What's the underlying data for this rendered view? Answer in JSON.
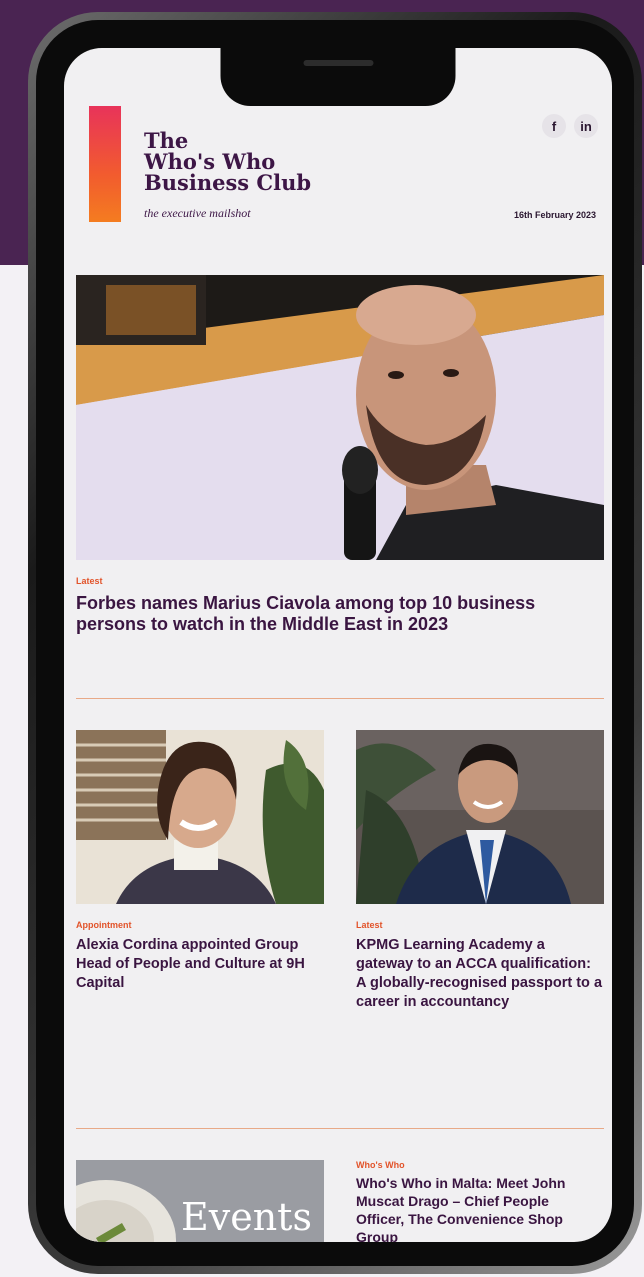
{
  "header": {
    "logo_line1": "The",
    "logo_line2": "Who's Who",
    "logo_line3": "Business Club",
    "tagline": "the executive mailshot",
    "social": [
      {
        "label": "f",
        "icon": "facebook-icon"
      },
      {
        "label": "in",
        "icon": "linkedin-icon"
      }
    ],
    "date": "16th February 2023"
  },
  "hero": {
    "category": "Latest",
    "title": "Forbes names Marius Ciavola among top 10 business persons to watch in the Middle East in 2023"
  },
  "cards": [
    {
      "category": "Appointment",
      "title": "Alexia Cordina appointed Group Head of People and Culture at 9H Capital"
    },
    {
      "category": "Latest",
      "title": "KPMG Learning Academy a gateway to an ACCA qualification: A globally-recognised passport to a career in accountancy"
    }
  ],
  "bottom": {
    "image_text": "Events",
    "category": "Who's Who",
    "title": "Who's Who in Malta: Meet John Muscat Drago – Chief People Officer, The Convenience Shop Group"
  },
  "colors": {
    "brand_purple": "#3d1646",
    "accent_orange": "#e2542b",
    "background_band": "#4a2452"
  }
}
